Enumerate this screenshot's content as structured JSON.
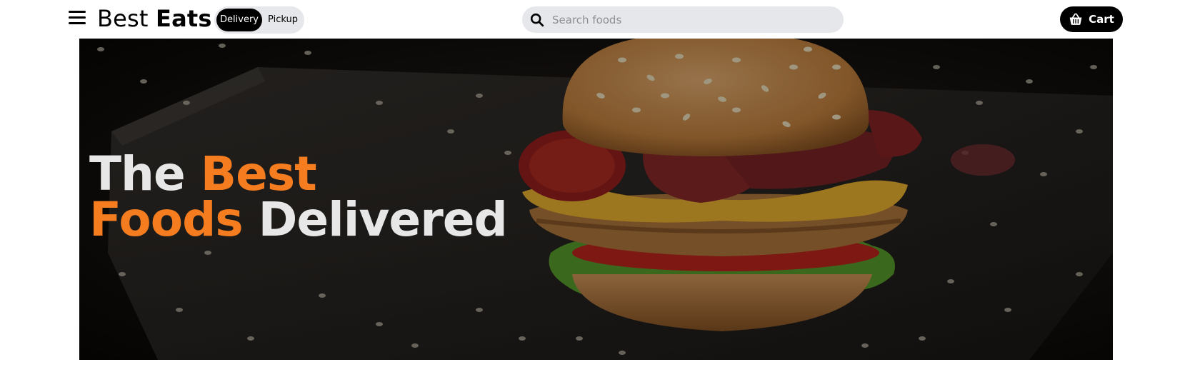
{
  "header": {
    "brand_part1": "Best",
    "brand_part2": "Eats",
    "toggle": {
      "options": [
        "Delivery",
        "Pickup"
      ],
      "selected": "Delivery"
    },
    "search": {
      "placeholder": "Search foods",
      "value": ""
    },
    "cart_label": "Cart",
    "icons": {
      "menu": "hamburger-menu-icon",
      "search": "search-icon",
      "cart": "shopping-basket-icon"
    }
  },
  "hero": {
    "headline": {
      "line1_white": "The",
      "line1_orange": "Best",
      "line2_orange": "Foods",
      "line2_white": "Delivered"
    },
    "accent_color": "#f57c1f",
    "text_color": "#e7e7e7",
    "image": "burger-on-dark-board"
  },
  "colors": {
    "black": "#000000",
    "pill_gray": "#e5e7eb"
  }
}
